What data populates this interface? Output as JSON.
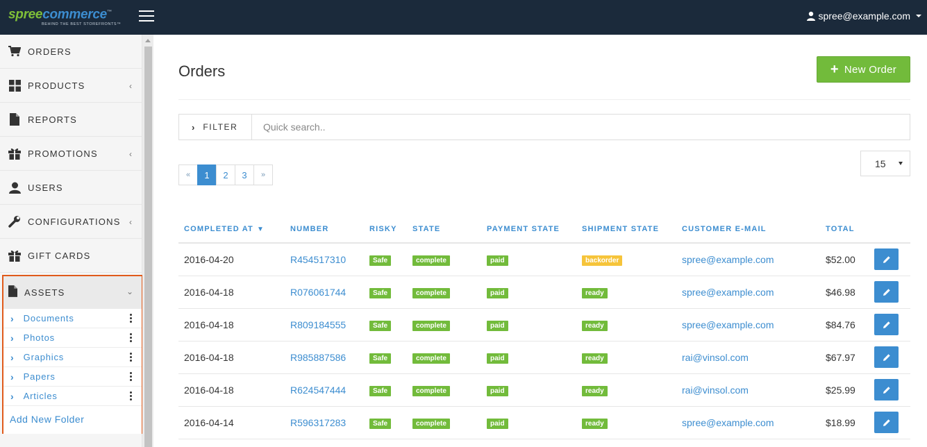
{
  "header": {
    "logo_spree": "spree",
    "logo_commerce": "commerce",
    "logo_tm": "™",
    "logo_tagline": "BEHIND THE BEST STOREFRONTS™",
    "user_email": "spree@example.com"
  },
  "sidebar": {
    "items": [
      {
        "label": "ORDERS",
        "icon": "cart-icon"
      },
      {
        "label": "PRODUCTS",
        "icon": "th-large-icon",
        "chevron": "‹"
      },
      {
        "label": "REPORTS",
        "icon": "file-icon"
      },
      {
        "label": "PROMOTIONS",
        "icon": "gift-icon",
        "chevron": "‹"
      },
      {
        "label": "USERS",
        "icon": "user-icon"
      },
      {
        "label": "CONFIGURATIONS",
        "icon": "wrench-icon",
        "chevron": "‹"
      },
      {
        "label": "GIFT CARDS",
        "icon": "gift-icon"
      }
    ],
    "assets": {
      "label": "ASSETS",
      "chevron": "⌄",
      "folders": [
        "Documents",
        "Photos",
        "Graphics",
        "Papers",
        "Articles"
      ],
      "add_folder": "Add New Folder"
    }
  },
  "main": {
    "title": "Orders",
    "new_order_label": "New Order",
    "filter_label": "FILTER",
    "search_placeholder": "Quick search..",
    "per_page": "15",
    "pagination": {
      "prev": "«",
      "pages": [
        "1",
        "2",
        "3"
      ],
      "next": "»",
      "active": "1"
    },
    "table": {
      "headers": [
        "COMPLETED AT",
        "NUMBER",
        "RISKY",
        "STATE",
        "PAYMENT STATE",
        "SHIPMENT STATE",
        "CUSTOMER E-MAIL",
        "TOTAL"
      ],
      "rows": [
        {
          "date": "2016-04-20",
          "number": "R454517310",
          "risky": "Safe",
          "state": "complete",
          "payment": "paid",
          "shipment": "backorder",
          "email": "spree@example.com",
          "total": "$52.00"
        },
        {
          "date": "2016-04-18",
          "number": "R076061744",
          "risky": "Safe",
          "state": "complete",
          "payment": "paid",
          "shipment": "ready",
          "email": "spree@example.com",
          "total": "$46.98"
        },
        {
          "date": "2016-04-18",
          "number": "R809184555",
          "risky": "Safe",
          "state": "complete",
          "payment": "paid",
          "shipment": "ready",
          "email": "spree@example.com",
          "total": "$84.76"
        },
        {
          "date": "2016-04-18",
          "number": "R985887586",
          "risky": "Safe",
          "state": "complete",
          "payment": "paid",
          "shipment": "ready",
          "email": "rai@vinsol.com",
          "total": "$67.97"
        },
        {
          "date": "2016-04-18",
          "number": "R624547444",
          "risky": "Safe",
          "state": "complete",
          "payment": "paid",
          "shipment": "ready",
          "email": "rai@vinsol.com",
          "total": "$25.99"
        },
        {
          "date": "2016-04-14",
          "number": "R596317283",
          "risky": "Safe",
          "state": "complete",
          "payment": "paid",
          "shipment": "ready",
          "email": "spree@example.com",
          "total": "$18.99"
        }
      ]
    }
  },
  "colors": {
    "topbar": "#1b2a3b",
    "link": "#3c8dd0",
    "success": "#72bb3b",
    "warning": "#f6c43a",
    "highlight_border": "#e05a1a"
  }
}
